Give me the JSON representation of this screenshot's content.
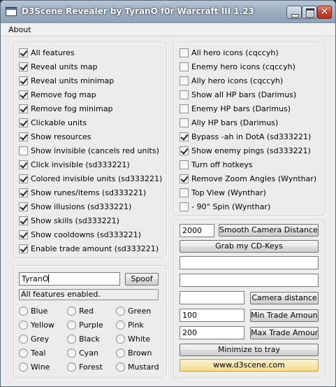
{
  "window": {
    "title": "D3Scene Revealer by TyranO f0r Warcraft III 1.23"
  },
  "menu": {
    "about": "About"
  },
  "left_features": [
    {
      "label": "All features",
      "checked": true
    },
    {
      "label": "Reveal units map",
      "checked": true
    },
    {
      "label": "Reveal units minimap",
      "checked": true
    },
    {
      "label": "Remove fog map",
      "checked": true
    },
    {
      "label": "Remove fog minimap",
      "checked": true
    },
    {
      "label": "Clickable units",
      "checked": true
    },
    {
      "label": "Show resources",
      "checked": true
    },
    {
      "label": "Show invisible (cancels red units)",
      "checked": false
    },
    {
      "label": "Click invisible (sd333221)",
      "checked": true
    },
    {
      "label": "Colored invisible units (sd333221)",
      "checked": true
    },
    {
      "label": "Show runes/items (sd333221)",
      "checked": true
    },
    {
      "label": "Show illusions (sd333221)",
      "checked": true
    },
    {
      "label": "Show skills (sd333221)",
      "checked": true
    },
    {
      "label": "Show cooldowns (sd333221)",
      "checked": true
    },
    {
      "label": "Enable trade amount (sd333221)",
      "checked": true
    }
  ],
  "right_features": [
    {
      "label": "All hero icons (cqccyh)",
      "checked": false
    },
    {
      "label": "Enemy hero icons (cqccyh)",
      "checked": false
    },
    {
      "label": "Ally hero icons (cqccyh)",
      "checked": false
    },
    {
      "label": "Show all HP bars (Darimus)",
      "checked": false
    },
    {
      "label": "Enemy HP bars (Darimus)",
      "checked": false
    },
    {
      "label": "Ally HP bars (Darimus)",
      "checked": false
    },
    {
      "label": "Bypass -ah in DotA (sd333221)",
      "checked": true
    },
    {
      "label": "Show enemy pings (sd333221)",
      "checked": true
    },
    {
      "label": "Turn off hotkeys",
      "checked": false
    },
    {
      "label": "Remove Zoom Angles (Wynthar)",
      "checked": true
    },
    {
      "label": "Top View (Wynthar)",
      "checked": false
    },
    {
      "label": "- 90° Spin (Wynthar)",
      "checked": false
    }
  ],
  "spoof": {
    "name_value": "TyranO",
    "button": "Spoof",
    "status": "All features enabled."
  },
  "colors": [
    [
      "Blue",
      "Red",
      "Green"
    ],
    [
      "Yellow",
      "Purple",
      "Pink"
    ],
    [
      "Grey",
      "Black",
      "White"
    ],
    [
      "Teal",
      "Cyan",
      "Brown"
    ],
    [
      "Wine",
      "Forest",
      "Mustard"
    ]
  ],
  "controls": {
    "camera_distance_value": "2000",
    "smooth_camera_button": "Smooth Camera Distance",
    "grab_cdkeys_button": "Grab my CD-Keys",
    "cdkey_field1": "",
    "cdkey_field2": "",
    "camera_field": "",
    "camera_distance_button": "Camera distance",
    "min_trade_value": "100",
    "min_trade_button": "Min Trade Amount",
    "max_trade_value": "200",
    "max_trade_button": "Max Trade Amount",
    "minimize_button": "Minimize to tray",
    "website_button": "www.d3scene.com"
  }
}
